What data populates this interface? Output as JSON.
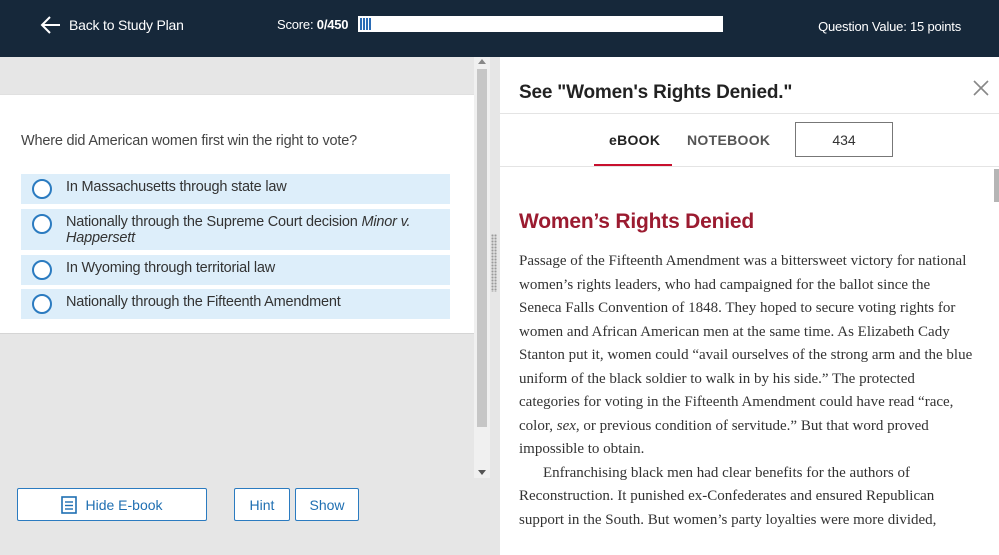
{
  "topbar": {
    "back_label": "Back to Study Plan",
    "score_label": "Score:",
    "score_value": "0/450",
    "question_value": "Question Value: 15 points",
    "progress_fraction": 0
  },
  "question": {
    "text": "Where did American women first win the right to vote?",
    "options": [
      {
        "text": "In Massachusetts through state law"
      },
      {
        "text": "Nationally through the Supreme Court decision ",
        "italic": "Minor v. Happersett"
      },
      {
        "text": "In Wyoming through territorial law"
      },
      {
        "text": "Nationally through the Fifteenth Amendment"
      }
    ]
  },
  "buttons": {
    "hide_ebook": "Hide E-book",
    "hint": "Hint",
    "show": "Show"
  },
  "ebook_panel": {
    "title": "See \"Women's Rights Denied.\"",
    "tabs": [
      "eBOOK",
      "NOTEBOOK"
    ],
    "page_number": "434",
    "section_title": "Women’s Rights Denied",
    "paragraph1": "Passage of the Fifteenth Amendment was a bittersweet victory for national women’s rights leaders, who had campaigned for the ballot since the Seneca Falls Convention of 1848. They hoped to secure voting rights for women and African American men at the same time. As Elizabeth Cady Stanton put it, women could “avail ourselves of the strong arm and the blue uniform of the black soldier to walk in by his side.” The protected categories for voting in the Fifteenth Amendment could have read “race, color, ",
    "paragraph1_italic": "sex",
    "paragraph1_end": ", or previous condition of servitude.” But that word proved impossible to obtain.",
    "paragraph2": "Enfranchising black men had clear benefits for the authors of Reconstruction. It punished ex-Confederates and ensured Republican support in the South. But women’s party loyalties were more divided,"
  },
  "colors": {
    "topbar_bg": "#16283a",
    "accent_blue": "#2b7bc0",
    "option_bg": "#ddeefa",
    "section_title_red": "#9b1b30",
    "tab_underline": "#c8102e"
  },
  "icons": {
    "back": "arrow-left-icon",
    "close": "close-icon",
    "ebook": "document-icon"
  }
}
